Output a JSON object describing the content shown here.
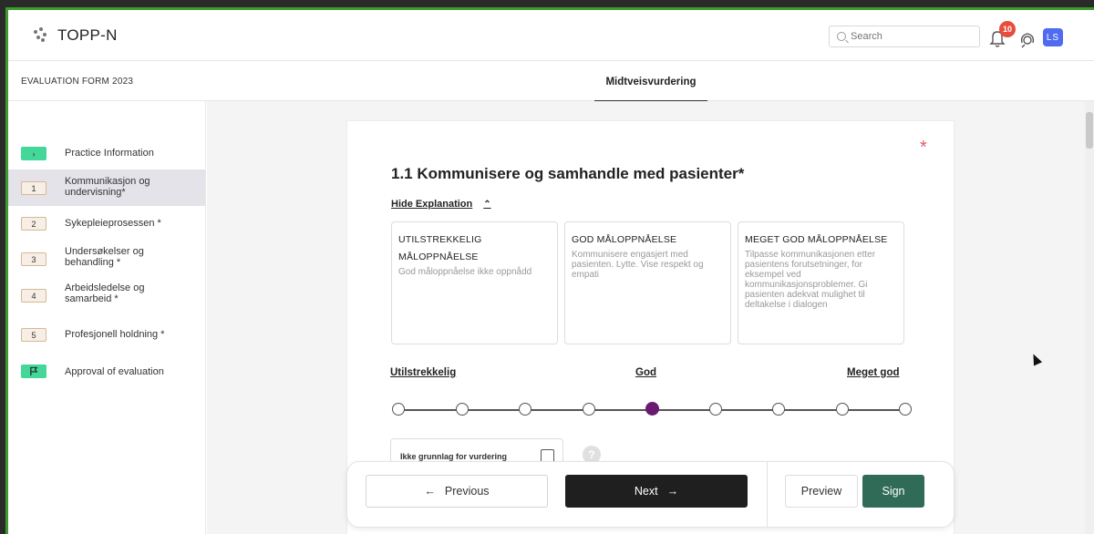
{
  "app": {
    "name": "TOPP-N"
  },
  "header": {
    "search_placeholder": "Search",
    "notification_count": "10",
    "user_initials": "LS"
  },
  "subheader": {
    "form_label": "EVALUATION FORM 2023",
    "active_tab": "Midtveisvurdering"
  },
  "sidebar": {
    "items": [
      {
        "chip": "›",
        "label": "Practice Information",
        "chip_style": "green"
      },
      {
        "chip": "1",
        "label": "Kommunikasjon og undervisning*",
        "chip_style": "num",
        "active": true
      },
      {
        "chip": "2",
        "label": "Sykepleieprosessen *",
        "chip_style": "num"
      },
      {
        "chip": "3",
        "label": "Undersøkelser og behandling *",
        "chip_style": "num"
      },
      {
        "chip": "4",
        "label": "Arbeidsledelse og samarbeid *",
        "chip_style": "num"
      },
      {
        "chip": "5",
        "label": "Profesjonell holdning *",
        "chip_style": "num"
      },
      {
        "chip": "flag",
        "label": "Approval of evaluation",
        "chip_style": "green"
      }
    ]
  },
  "question": {
    "required_mark": "*",
    "title": "1.1 Kommunisere og samhandle med pasienter*",
    "toggle_label": "Hide Explanation",
    "explanations": [
      {
        "heading_line1": "UTILSTREKKELIG",
        "heading_line2": "MÅLOPPNÅELSE",
        "body": "God måloppnåelse ikke oppnådd"
      },
      {
        "heading_line1": "GOD MÅLOPPNÅELSE",
        "heading_line2": "",
        "body": "Kommunisere engasjert med pasienten. Lytte. Vise respekt og empati"
      },
      {
        "heading_line1": "MEGET GOD MÅLOPPNÅELSE",
        "heading_line2": "",
        "body": "Tilpasse kommunikasjonen etter pasientens forutsetninger, for eksempel ved kommunikasjonsproblemer. Gi pasienten adekvat mulighet til deltakelse i dialogen"
      }
    ],
    "scale": {
      "label_low": "Utilstrekkelig",
      "label_mid": "God",
      "label_high": "Meget god",
      "steps": 9,
      "selected_index": 4
    },
    "no_basis_label": "Ikke grunnlag for vurdering",
    "no_basis_checked": false,
    "help_symbol": "?"
  },
  "footer": {
    "previous_label": "Previous",
    "next_label": "Next",
    "preview_label": "Preview",
    "sign_label": "Sign"
  },
  "colors": {
    "selected_dot": "#6a1a70",
    "sign_button": "#2f6b57",
    "next_button": "#1f1f1f",
    "green_chip": "#43d79a",
    "notification_badge": "#e74c3c",
    "avatar": "#4f6cf0",
    "required_mark": "#e05a6a"
  }
}
